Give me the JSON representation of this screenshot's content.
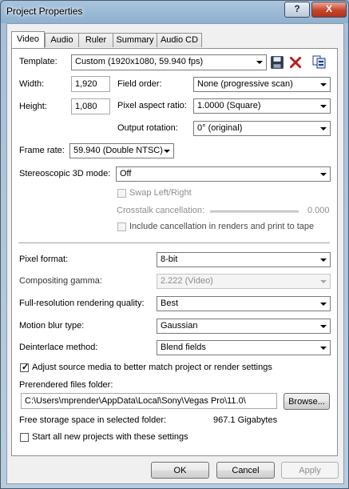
{
  "window": {
    "title": "Project Properties",
    "help_label": "?",
    "close_label": "X"
  },
  "tabs": [
    {
      "label": "Video",
      "active": true
    },
    {
      "label": "Audio",
      "active": false
    },
    {
      "label": "Ruler",
      "active": false
    },
    {
      "label": "Summary",
      "active": false
    },
    {
      "label": "Audio CD",
      "active": false
    }
  ],
  "video": {
    "template_label": "Template:",
    "template_value": "Custom (1920x1080, 59.940 fps)",
    "width_label": "Width:",
    "width_value": "1,920",
    "height_label": "Height:",
    "height_value": "1,080",
    "field_order_label": "Field order:",
    "field_order_value": "None (progressive scan)",
    "pixel_aspect_label": "Pixel aspect ratio:",
    "pixel_aspect_value": "1.0000 (Square)",
    "output_rotation_label": "Output rotation:",
    "output_rotation_value": "0° (original)",
    "frame_rate_label": "Frame rate:",
    "frame_rate_value": "59.940 (Double NTSC)",
    "stereo_label": "Stereoscopic 3D mode:",
    "stereo_value": "Off",
    "swap_label": "Swap Left/Right",
    "swap_checked": false,
    "crosstalk_label": "Crosstalk cancellation:",
    "crosstalk_value": "0.000",
    "include_cancellation_label": "Include cancellation in renders and print to tape",
    "include_cancellation_checked": false,
    "pixel_format_label": "Pixel format:",
    "pixel_format_value": "8-bit",
    "compositing_gamma_label": "Compositing gamma:",
    "compositing_gamma_value": "2.222 (Video)",
    "rendering_quality_label": "Full-resolution rendering quality:",
    "rendering_quality_value": "Best",
    "motion_blur_label": "Motion blur type:",
    "motion_blur_value": "Gaussian",
    "deinterlace_label": "Deinterlace method:",
    "deinterlace_value": "Blend fields",
    "adjust_source_label": "Adjust source media to better match project or render settings",
    "adjust_source_checked": true,
    "prerendered_label": "Prerendered files folder:",
    "prerendered_value": "C:\\Users\\mprender\\AppData\\Local\\Sony\\Vegas Pro\\11.0\\",
    "browse_label": "Browse...",
    "free_storage_label": "Free storage space in selected folder:",
    "free_storage_value": "967.1 Gigabytes",
    "start_new_label": "Start all new projects with these settings",
    "start_new_checked": false
  },
  "buttons": {
    "ok": "OK",
    "cancel": "Cancel",
    "apply": "Apply"
  },
  "icons": {
    "save": "save-icon",
    "delete": "delete-icon",
    "match_media": "match-media-icon"
  }
}
